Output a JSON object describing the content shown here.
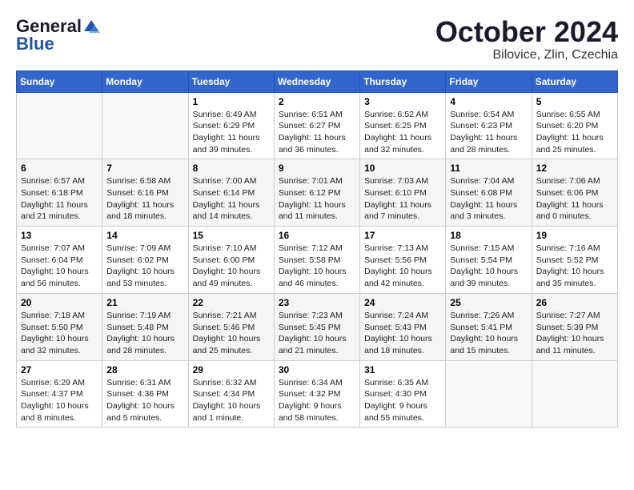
{
  "header": {
    "logo_general": "General",
    "logo_blue": "Blue",
    "month": "October 2024",
    "location": "Bilovice, Zlin, Czechia"
  },
  "days_of_week": [
    "Sunday",
    "Monday",
    "Tuesday",
    "Wednesday",
    "Thursday",
    "Friday",
    "Saturday"
  ],
  "weeks": [
    [
      {
        "day": "",
        "info": ""
      },
      {
        "day": "",
        "info": ""
      },
      {
        "day": "1",
        "info": "Sunrise: 6:49 AM\nSunset: 6:29 PM\nDaylight: 11 hours and 39 minutes."
      },
      {
        "day": "2",
        "info": "Sunrise: 6:51 AM\nSunset: 6:27 PM\nDaylight: 11 hours and 36 minutes."
      },
      {
        "day": "3",
        "info": "Sunrise: 6:52 AM\nSunset: 6:25 PM\nDaylight: 11 hours and 32 minutes."
      },
      {
        "day": "4",
        "info": "Sunrise: 6:54 AM\nSunset: 6:23 PM\nDaylight: 11 hours and 28 minutes."
      },
      {
        "day": "5",
        "info": "Sunrise: 6:55 AM\nSunset: 6:20 PM\nDaylight: 11 hours and 25 minutes."
      }
    ],
    [
      {
        "day": "6",
        "info": "Sunrise: 6:57 AM\nSunset: 6:18 PM\nDaylight: 11 hours and 21 minutes."
      },
      {
        "day": "7",
        "info": "Sunrise: 6:58 AM\nSunset: 6:16 PM\nDaylight: 11 hours and 18 minutes."
      },
      {
        "day": "8",
        "info": "Sunrise: 7:00 AM\nSunset: 6:14 PM\nDaylight: 11 hours and 14 minutes."
      },
      {
        "day": "9",
        "info": "Sunrise: 7:01 AM\nSunset: 6:12 PM\nDaylight: 11 hours and 11 minutes."
      },
      {
        "day": "10",
        "info": "Sunrise: 7:03 AM\nSunset: 6:10 PM\nDaylight: 11 hours and 7 minutes."
      },
      {
        "day": "11",
        "info": "Sunrise: 7:04 AM\nSunset: 6:08 PM\nDaylight: 11 hours and 3 minutes."
      },
      {
        "day": "12",
        "info": "Sunrise: 7:06 AM\nSunset: 6:06 PM\nDaylight: 11 hours and 0 minutes."
      }
    ],
    [
      {
        "day": "13",
        "info": "Sunrise: 7:07 AM\nSunset: 6:04 PM\nDaylight: 10 hours and 56 minutes."
      },
      {
        "day": "14",
        "info": "Sunrise: 7:09 AM\nSunset: 6:02 PM\nDaylight: 10 hours and 53 minutes."
      },
      {
        "day": "15",
        "info": "Sunrise: 7:10 AM\nSunset: 6:00 PM\nDaylight: 10 hours and 49 minutes."
      },
      {
        "day": "16",
        "info": "Sunrise: 7:12 AM\nSunset: 5:58 PM\nDaylight: 10 hours and 46 minutes."
      },
      {
        "day": "17",
        "info": "Sunrise: 7:13 AM\nSunset: 5:56 PM\nDaylight: 10 hours and 42 minutes."
      },
      {
        "day": "18",
        "info": "Sunrise: 7:15 AM\nSunset: 5:54 PM\nDaylight: 10 hours and 39 minutes."
      },
      {
        "day": "19",
        "info": "Sunrise: 7:16 AM\nSunset: 5:52 PM\nDaylight: 10 hours and 35 minutes."
      }
    ],
    [
      {
        "day": "20",
        "info": "Sunrise: 7:18 AM\nSunset: 5:50 PM\nDaylight: 10 hours and 32 minutes."
      },
      {
        "day": "21",
        "info": "Sunrise: 7:19 AM\nSunset: 5:48 PM\nDaylight: 10 hours and 28 minutes."
      },
      {
        "day": "22",
        "info": "Sunrise: 7:21 AM\nSunset: 5:46 PM\nDaylight: 10 hours and 25 minutes."
      },
      {
        "day": "23",
        "info": "Sunrise: 7:23 AM\nSunset: 5:45 PM\nDaylight: 10 hours and 21 minutes."
      },
      {
        "day": "24",
        "info": "Sunrise: 7:24 AM\nSunset: 5:43 PM\nDaylight: 10 hours and 18 minutes."
      },
      {
        "day": "25",
        "info": "Sunrise: 7:26 AM\nSunset: 5:41 PM\nDaylight: 10 hours and 15 minutes."
      },
      {
        "day": "26",
        "info": "Sunrise: 7:27 AM\nSunset: 5:39 PM\nDaylight: 10 hours and 11 minutes."
      }
    ],
    [
      {
        "day": "27",
        "info": "Sunrise: 6:29 AM\nSunset: 4:37 PM\nDaylight: 10 hours and 8 minutes."
      },
      {
        "day": "28",
        "info": "Sunrise: 6:31 AM\nSunset: 4:36 PM\nDaylight: 10 hours and 5 minutes."
      },
      {
        "day": "29",
        "info": "Sunrise: 6:32 AM\nSunset: 4:34 PM\nDaylight: 10 hours and 1 minute."
      },
      {
        "day": "30",
        "info": "Sunrise: 6:34 AM\nSunset: 4:32 PM\nDaylight: 9 hours and 58 minutes."
      },
      {
        "day": "31",
        "info": "Sunrise: 6:35 AM\nSunset: 4:30 PM\nDaylight: 9 hours and 55 minutes."
      },
      {
        "day": "",
        "info": ""
      },
      {
        "day": "",
        "info": ""
      }
    ]
  ]
}
